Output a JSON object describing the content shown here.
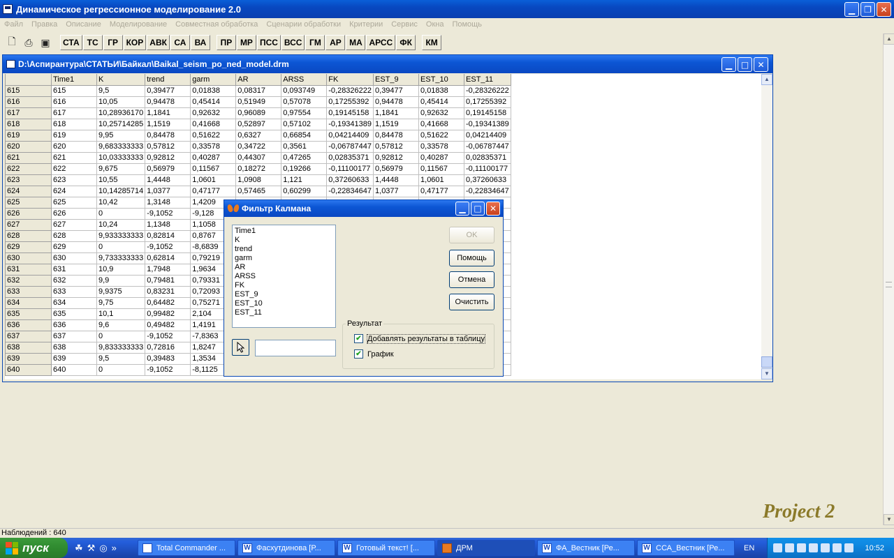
{
  "window": {
    "title": "Динамическое регрессионное моделирование 2.0"
  },
  "menu": [
    "Файл",
    "Правка",
    "Описание",
    "Моделирование",
    "Совместная обработка",
    "Сценарии обработки",
    "Критерии",
    "Сервис",
    "Окна",
    "Помощь"
  ],
  "toolbar": {
    "buttons": [
      "СТА",
      "ТС",
      "ГР",
      "КОР",
      "АВК",
      "СА",
      "ВА",
      "ПР",
      "МР",
      "ПСС",
      "ВСС",
      "ГМ",
      "АР",
      "МА",
      "АРСС",
      "ФК",
      "КМ"
    ]
  },
  "child": {
    "title": "D:\\Аспирантура\\СТАТЬИ\\Байкал\\Baikal_seism_po_ned_model.drm",
    "columns": [
      "",
      "Time1",
      "K",
      "trend",
      "garm",
      "AR",
      "ARSS",
      "FK",
      "EST_9",
      "EST_10",
      "EST_11"
    ],
    "rows": [
      [
        "615",
        "615",
        "9,5",
        "0,39477",
        "0,01838",
        "0,08317",
        "0,093749",
        "-0,28326222",
        "0,39477",
        "0,01838",
        "-0,28326222"
      ],
      [
        "616",
        "616",
        "10,05",
        "0,94478",
        "0,45414",
        "0,51949",
        "0,57078",
        "0,17255392",
        "0,94478",
        "0,45414",
        "0,17255392"
      ],
      [
        "617",
        "617",
        "10,28936170",
        "1,1841",
        "0,92632",
        "0,96089",
        "0,97554",
        "0,19145158",
        "1,1841",
        "0,92632",
        "0,19145158"
      ],
      [
        "618",
        "618",
        "10,25714285",
        "1,1519",
        "0,41668",
        "0,52897",
        "0,57102",
        "-0,19341389",
        "1,1519",
        "0,41668",
        "-0,19341389"
      ],
      [
        "619",
        "619",
        "9,95",
        "0,84478",
        "0,51622",
        "0,6327",
        "0,66854",
        "0,04214409",
        "0,84478",
        "0,51622",
        "0,04214409"
      ],
      [
        "620",
        "620",
        "9,683333333",
        "0,57812",
        "0,33578",
        "0,34722",
        "0,3561",
        "-0,06787447",
        "0,57812",
        "0,33578",
        "-0,06787447"
      ],
      [
        "621",
        "621",
        "10,03333333",
        "0,92812",
        "0,40287",
        "0,44307",
        "0,47265",
        "0,02835371",
        "0,92812",
        "0,40287",
        "0,02835371"
      ],
      [
        "622",
        "622",
        "9,675",
        "0,56979",
        "0,11567",
        "0,18272",
        "0,19266",
        "-0,11100177",
        "0,56979",
        "0,11567",
        "-0,11100177"
      ],
      [
        "623",
        "623",
        "10,55",
        "1,4448",
        "1,0601",
        "1,0908",
        "1,121",
        "0,37260633",
        "1,4448",
        "1,0601",
        "0,37260633"
      ],
      [
        "624",
        "624",
        "10,14285714",
        "1,0377",
        "0,47177",
        "0,57465",
        "0,60299",
        "-0,22834647",
        "1,0377",
        "0,47177",
        "-0,22834647"
      ],
      [
        "625",
        "625",
        "10,42",
        "1,3148",
        "1,4209",
        "",
        "",
        "",
        "",
        "",
        ""
      ],
      [
        "626",
        "626",
        "0",
        "-9,1052",
        "-9,128",
        "",
        "",
        "",
        "",
        "",
        ""
      ],
      [
        "627",
        "627",
        "10,24",
        "1,1348",
        "1,1058",
        "",
        "",
        "",
        "",
        "",
        ""
      ],
      [
        "628",
        "628",
        "9,933333333",
        "0,82814",
        "0,8767",
        "",
        "",
        "",
        "",
        "",
        ""
      ],
      [
        "629",
        "629",
        "0",
        "-9,1052",
        "-8,6839",
        "",
        "",
        "",
        "",
        "",
        ""
      ],
      [
        "630",
        "630",
        "9,733333333",
        "0,62814",
        "0,79219",
        "",
        "",
        "",
        "",
        "",
        ""
      ],
      [
        "631",
        "631",
        "10,9",
        "1,7948",
        "1,9634",
        "",
        "",
        "",
        "",
        "",
        ""
      ],
      [
        "632",
        "632",
        "9,9",
        "0,79481",
        "0,79331",
        "",
        "",
        "",
        "",
        "",
        ""
      ],
      [
        "633",
        "633",
        "9,9375",
        "0,83231",
        "0,72093",
        "",
        "",
        "",
        "",
        "",
        ""
      ],
      [
        "634",
        "634",
        "9,75",
        "0,64482",
        "0,75271",
        "",
        "",
        "",
        "",
        "",
        ""
      ],
      [
        "635",
        "635",
        "10,1",
        "0,99482",
        "2,104",
        "",
        "",
        "",
        "",
        "",
        ""
      ],
      [
        "636",
        "636",
        "9,6",
        "0,49482",
        "1,4191",
        "",
        "",
        "",
        "",
        "",
        ""
      ],
      [
        "637",
        "637",
        "0",
        "-9,1052",
        "-7,8363",
        "",
        "",
        "",
        "",
        "",
        ""
      ],
      [
        "638",
        "638",
        "9,833333333",
        "0,72816",
        "1,8247",
        "",
        "",
        "",
        "",
        "",
        ""
      ],
      [
        "639",
        "639",
        "9,5",
        "0,39483",
        "1,3534",
        "",
        "",
        "",
        "",
        "",
        ""
      ],
      [
        "640",
        "640",
        "0",
        "-9,1052",
        "-8,1125",
        "",
        "",
        "",
        "",
        "",
        ""
      ]
    ]
  },
  "dialog": {
    "title": "Фильтр Калмана",
    "variables": [
      "Time1",
      "K",
      "trend",
      "garm",
      "AR",
      "ARSS",
      "FK",
      "EST_9",
      "EST_10",
      "EST_11"
    ],
    "ok_label": "OK",
    "help_label": "Помощь",
    "cancel_label": "Отмена",
    "clear_label": "Очистить",
    "result_group": "Результат",
    "add_results_label": "Добавлять результаты в таблицу",
    "chart_label": "График",
    "add_results_checked": true,
    "chart_checked": true
  },
  "watermark": "Project 2",
  "status": {
    "text": "Наблюдений : 640"
  },
  "taskbar": {
    "start_label": "пуск",
    "tasks": [
      "Total Commander ...",
      "Фасхутдинова [Р...",
      "Готовый текст! [...",
      "ДРМ",
      "ФА_Вестник [Ре...",
      "ССА_Вестник [Ре..."
    ],
    "active_task": 3,
    "lang": "EN",
    "clock": "10:52"
  }
}
